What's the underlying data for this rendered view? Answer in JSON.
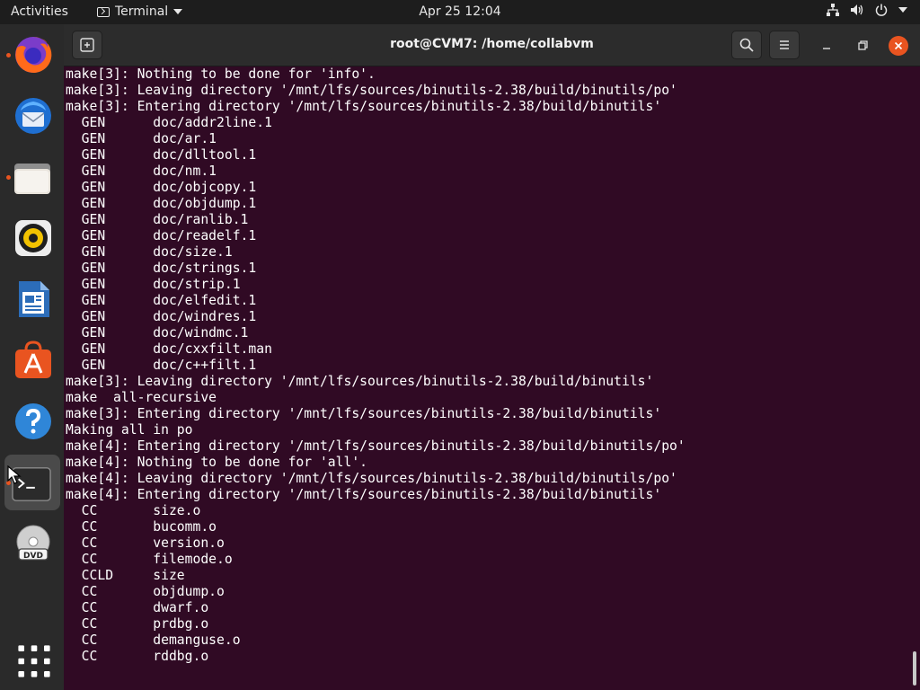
{
  "topbar": {
    "activities": "Activities",
    "app_menu_label": "Terminal",
    "clock": "Apr 25  12:04",
    "tray_icons": [
      "network-icon",
      "volume-icon",
      "power-icon",
      "chevron-down-icon"
    ]
  },
  "dock": {
    "items": [
      {
        "name": "firefox",
        "icon": "firefox-icon",
        "running": true
      },
      {
        "name": "thunderbird",
        "icon": "thunderbird-icon",
        "running": false
      },
      {
        "name": "files",
        "icon": "files-icon",
        "running": true
      },
      {
        "name": "rhythmbox",
        "icon": "rhythmbox-icon",
        "running": false
      },
      {
        "name": "libreoffice-writer",
        "icon": "writer-icon",
        "running": false
      },
      {
        "name": "ubuntu-software",
        "icon": "software-icon",
        "running": false
      },
      {
        "name": "help",
        "icon": "help-icon",
        "running": false
      },
      {
        "name": "terminal",
        "icon": "terminal-icon",
        "running": true,
        "active": true
      },
      {
        "name": "dvd",
        "icon": "dvd-icon",
        "running": false
      },
      {
        "name": "show-applications",
        "icon": "app-grid-icon",
        "running": false
      }
    ]
  },
  "window": {
    "title": "root@CVM7: /home/collabvm",
    "colors": {
      "terminal_bg": "#300a24",
      "accent": "#e95420"
    }
  },
  "terminal": {
    "lines": [
      "make[3]: Nothing to be done for 'info'.",
      "make[3]: Leaving directory '/mnt/lfs/sources/binutils-2.38/build/binutils/po'",
      "make[3]: Entering directory '/mnt/lfs/sources/binutils-2.38/build/binutils'",
      "  GEN      doc/addr2line.1",
      "  GEN      doc/ar.1",
      "  GEN      doc/dlltool.1",
      "  GEN      doc/nm.1",
      "  GEN      doc/objcopy.1",
      "  GEN      doc/objdump.1",
      "  GEN      doc/ranlib.1",
      "  GEN      doc/readelf.1",
      "  GEN      doc/size.1",
      "  GEN      doc/strings.1",
      "  GEN      doc/strip.1",
      "  GEN      doc/elfedit.1",
      "  GEN      doc/windres.1",
      "  GEN      doc/windmc.1",
      "  GEN      doc/cxxfilt.man",
      "  GEN      doc/c++filt.1",
      "make[3]: Leaving directory '/mnt/lfs/sources/binutils-2.38/build/binutils'",
      "make  all-recursive",
      "make[3]: Entering directory '/mnt/lfs/sources/binutils-2.38/build/binutils'",
      "Making all in po",
      "make[4]: Entering directory '/mnt/lfs/sources/binutils-2.38/build/binutils/po'",
      "make[4]: Nothing to be done for 'all'.",
      "make[4]: Leaving directory '/mnt/lfs/sources/binutils-2.38/build/binutils/po'",
      "make[4]: Entering directory '/mnt/lfs/sources/binutils-2.38/build/binutils'",
      "  CC       size.o",
      "  CC       bucomm.o",
      "  CC       version.o",
      "  CC       filemode.o",
      "  CCLD     size",
      "  CC       objdump.o",
      "  CC       dwarf.o",
      "  CC       prdbg.o",
      "  CC       demanguse.o",
      "  CC       rddbg.o"
    ]
  }
}
